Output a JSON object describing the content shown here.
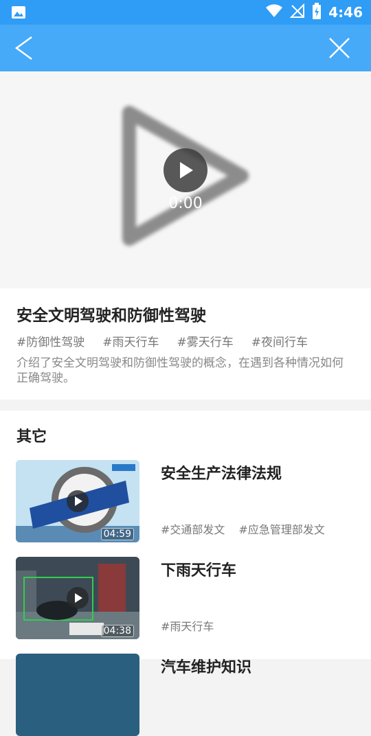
{
  "status_bar": {
    "time": "4:46"
  },
  "video": {
    "time_display": "0:00"
  },
  "info": {
    "title": "安全文明驾驶和防御性驾驶",
    "tags": [
      "#防御性驾驶",
      "#雨天行车",
      "#雾天行车",
      "#夜间行车"
    ],
    "description": "介绍了安全文明驾驶和防御性驾驶的概念，在遇到各种情况如何正确驾驶。"
  },
  "others": {
    "heading": "其它",
    "items": [
      {
        "title": "安全生产法律法规",
        "duration": "04:59",
        "tags": [
          "#交通部发文",
          "#应急管理部发文"
        ]
      },
      {
        "title": "下雨天行车",
        "duration": "04:38",
        "tags": [
          "#雨天行车"
        ]
      },
      {
        "title": "汽车维护知识",
        "duration": "",
        "tags": []
      }
    ]
  },
  "colors": {
    "primary": "#47aaf8",
    "status_bar": "#2f9cf5"
  }
}
